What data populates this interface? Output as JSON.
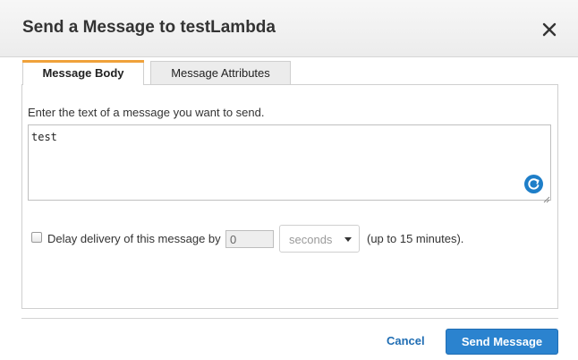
{
  "dialog": {
    "title": "Send a Message to testLambda",
    "close_icon": "close-icon"
  },
  "tabs": [
    {
      "label": "Message Body",
      "active": true
    },
    {
      "label": "Message Attributes",
      "active": false
    }
  ],
  "message_body": {
    "prompt": "Enter the text of a message you want to send.",
    "value": "test",
    "refresh_icon": "refresh-icon",
    "resize_icon": "resize-handle-icon"
  },
  "delay": {
    "checked": false,
    "label": "Delay delivery of this message by",
    "value": "0",
    "unit_selected": "seconds",
    "note": "(up to 15 minutes)."
  },
  "actions": {
    "cancel_label": "Cancel",
    "send_label": "Send Message"
  },
  "colors": {
    "accent_tab": "#f0a23b",
    "primary_button": "#2b83cf",
    "link": "#1f6db3"
  }
}
